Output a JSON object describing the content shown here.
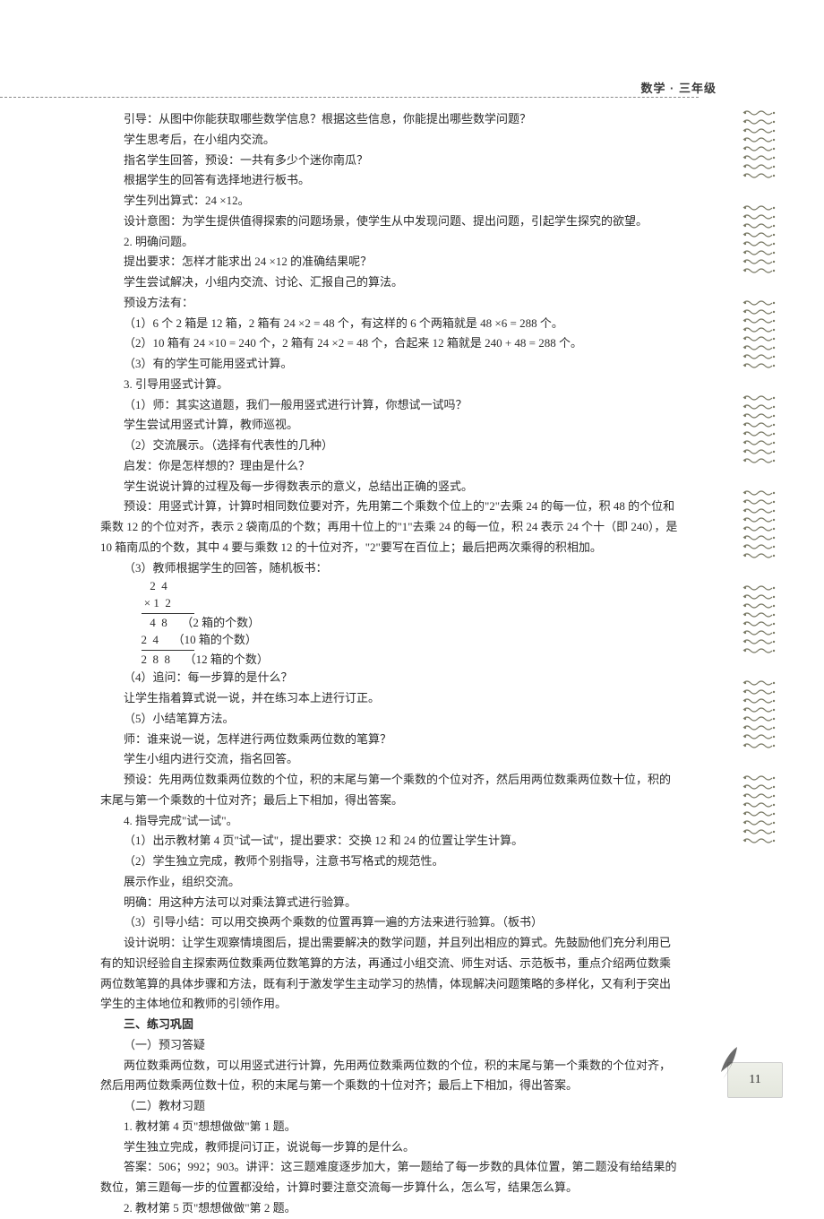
{
  "header": {
    "subject_grade": "数学 · 三年级"
  },
  "body": {
    "p1": "引导：从图中你能获取哪些数学信息？根据这些信息，你能提出哪些数学问题？",
    "p2": "学生思考后，在小组内交流。",
    "p3": "指名学生回答，预设：一共有多少个迷你南瓜？",
    "p4": "根据学生的回答有选择地进行板书。",
    "p5": "学生列出算式：24 ×12。",
    "p6": "设计意图：为学生提供值得探索的问题场景，使学生从中发现问题、提出问题，引起学生探究的欲望。",
    "p7": "2. 明确问题。",
    "p8": "提出要求：怎样才能求出 24 ×12 的准确结果呢？",
    "p9": "学生尝试解决，小组内交流、讨论、汇报自己的算法。",
    "p10": "预设方法有：",
    "p11": "（1）6 个 2 箱是 12 箱，2 箱有 24 ×2 = 48 个，有这样的 6 个两箱就是 48 ×6 = 288 个。",
    "p12": "（2）10 箱有 24 ×10 = 240 个，2 箱有 24 ×2 = 48 个，合起来 12 箱就是 240 + 48 = 288 个。",
    "p13": "（3）有的学生可能用竖式计算。",
    "p14": "3. 引导用竖式计算。",
    "p15": "（1）师：其实这道题，我们一般用竖式进行计算，你想试一试吗？",
    "p16": "学生尝试用竖式计算，教师巡视。",
    "p17": "（2）交流展示。（选择有代表性的几种）",
    "p18": "启发：你是怎样想的？理由是什么？",
    "p19": "学生说说计算的过程及每一步得数表示的意义，总结出正确的竖式。",
    "p20": "预设：用竖式计算，计算时相同数位要对齐，先用第二个乘数个位上的\"2\"去乘 24 的每一位，积 48 的个位和乘数 12 的个位对齐，表示 2 袋南瓜的个数；再用十位上的\"1\"去乘 24 的每一位，积 24 表示 24 个十（即 240），是 10 箱南瓜的个数，其中 4 要与乘数 12 的十位对齐，\"2\"要写在百位上；最后把两次乘得的积相加。",
    "p21": "（3）教师根据学生的回答，随机板书：",
    "calc": {
      "l1": "   2  4",
      "l2": " × 1  2",
      "l3": "   4  8",
      "n3": "（2 箱的个数）",
      "l4": "2  4",
      "n4": "（10 箱的个数）",
      "l5": "2  8  8",
      "n5": "（12 箱的个数）"
    },
    "p22": "（4）追问：每一步算的是什么？",
    "p23": "让学生指着算式说一说，并在练习本上进行订正。",
    "p24": "（5）小结笔算方法。",
    "p25": "师：谁来说一说，怎样进行两位数乘两位数的笔算？",
    "p26": "学生小组内进行交流，指名回答。",
    "p27": "预设：先用两位数乘两位数的个位，积的末尾与第一个乘数的个位对齐，然后用两位数乘两位数十位，积的末尾与第一个乘数的十位对齐；最后上下相加，得出答案。",
    "p28": "4. 指导完成\"试一试\"。",
    "p29": "（1）出示教材第 4 页\"试一试\"，提出要求：交换 12 和 24 的位置让学生计算。",
    "p30": "（2）学生独立完成，教师个别指导，注意书写格式的规范性。",
    "p31": "展示作业，组织交流。",
    "p32": "明确：用这种方法可以对乘法算式进行验算。",
    "p33": "（3）引导小结：可以用交换两个乘数的位置再算一遍的方法来进行验算。（板书）",
    "p34": "设计说明：让学生观察情境图后，提出需要解决的数学问题，并且列出相应的算式。先鼓励他们充分利用已有的知识经验自主探索两位数乘两位数笔算的方法，再通过小组交流、师生对话、示范板书，重点介绍两位数乘两位数笔算的具体步骤和方法，既有利于激发学生主动学习的热情，体现解决问题策略的多样化，又有利于突出学生的主体地位和教师的引领作用。",
    "h3": "三、练习巩固",
    "p35": "（一）预习答疑",
    "p36": "两位数乘两位数，可以用竖式进行计算，先用两位数乘两位数的个位，积的末尾与第一个乘数的个位对齐，然后用两位数乘两位数十位，积的末尾与第一个乘数的十位对齐；最后上下相加，得出答案。",
    "p37": "（二）教材习题",
    "p38": "1. 教材第 4 页\"想想做做\"第 1 题。",
    "p39": "学生独立完成，教师提问订正，说说每一步算的是什么。",
    "p40": "答案：506；992；903。讲评：这三题难度逐步加大，第一题给了每一步数的具体位置，第二题没有给结果的数位，第三题每一步的位置都没给，计算时要注意交流每一步算什么，怎么写，结果怎么算。",
    "p41": "2. 教材第 5 页\"想想做做\"第 2 题。"
  },
  "page_number": "11"
}
